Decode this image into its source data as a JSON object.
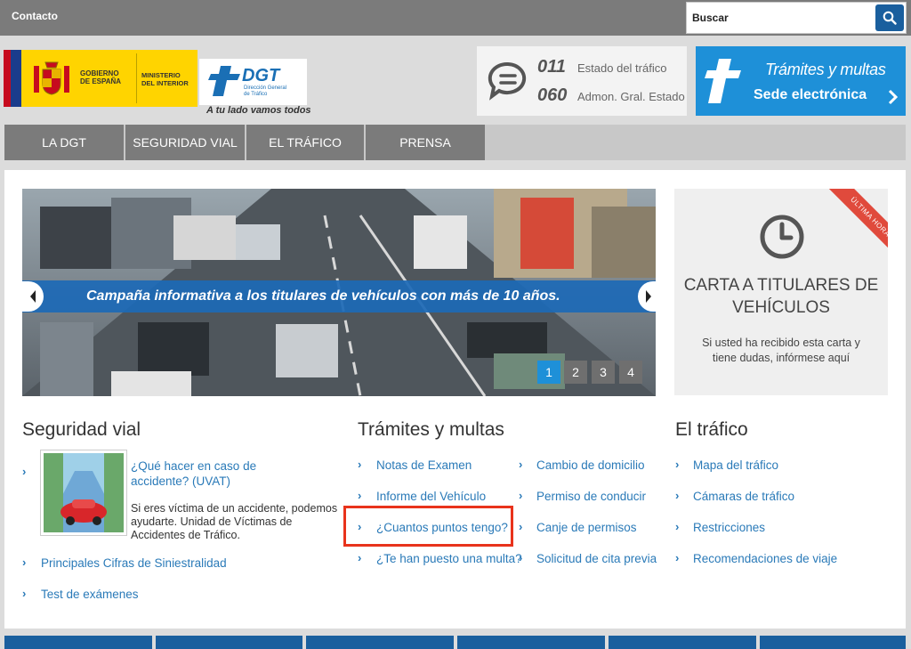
{
  "topbar": {
    "contact": "Contacto",
    "search_placeholder": "Buscar",
    "search_icon": "search-icon"
  },
  "header": {
    "gov_line1": "GOBIERNO",
    "gov_line2": "DE ESPAÑA",
    "ministry_line1": "MINISTERIO",
    "ministry_line2": "DEL INTERIOR",
    "dgt_name": "DGT",
    "dgt_sub1": "Dirección General",
    "dgt_sub2": "de Tráfico",
    "slogan": "A tu lado vamos todos",
    "phones": [
      {
        "number": "011",
        "label": "Estado del tráfico"
      },
      {
        "number": "060",
        "label": "Admon. Gral. Estado"
      }
    ],
    "sede_line1": "Trámites y multas",
    "sede_line2": "Sede electrónica"
  },
  "nav": {
    "items": [
      "LA DGT",
      "SEGURIDAD VIAL",
      "EL TRÁFICO",
      "PRENSA"
    ]
  },
  "slider": {
    "caption": "Campaña informativa a los titulares de vehículos con más de 10 años.",
    "pages": [
      "1",
      "2",
      "3",
      "4"
    ],
    "active_page": "1"
  },
  "alert": {
    "ribbon": "ÚLTIMA HORA",
    "title": "CARTA A TITULARES DE VEHÍCULOS",
    "description": "Si usted ha recibido esta carta y tiene dudas, infórmese aquí"
  },
  "seguridad": {
    "title": "Seguridad vial",
    "uvat_link": "¿Qué hacer en caso de accidente? (UVAT)",
    "uvat_text": "Si eres víctima de un accidente, podemos ayudarte. Unidad de Víctimas de Accidentes de Tráfico.",
    "links": [
      "Principales Cifras de Siniestralidad",
      "Test de exámenes"
    ]
  },
  "tramites": {
    "title": "Trámites y multas",
    "col1": [
      "Notas de Examen",
      "Informe del Vehículo",
      "¿Cuantos puntos tengo?",
      "¿Te han puesto una multa?"
    ],
    "col2": [
      "Cambio de domicilio",
      "Permiso de conducir",
      "Canje de permisos",
      "Solicitud de cita previa"
    ]
  },
  "trafico": {
    "title": "El tráfico",
    "links": [
      "Mapa del tráfico",
      "Cámaras de tráfico",
      "Restricciones",
      "Recomendaciones de viaje"
    ]
  },
  "colors": {
    "brand_blue": "#1e90d8",
    "nav_gray": "#7b7b7b",
    "link_blue": "#2a7ab8",
    "highlight_red": "#e8331c"
  }
}
